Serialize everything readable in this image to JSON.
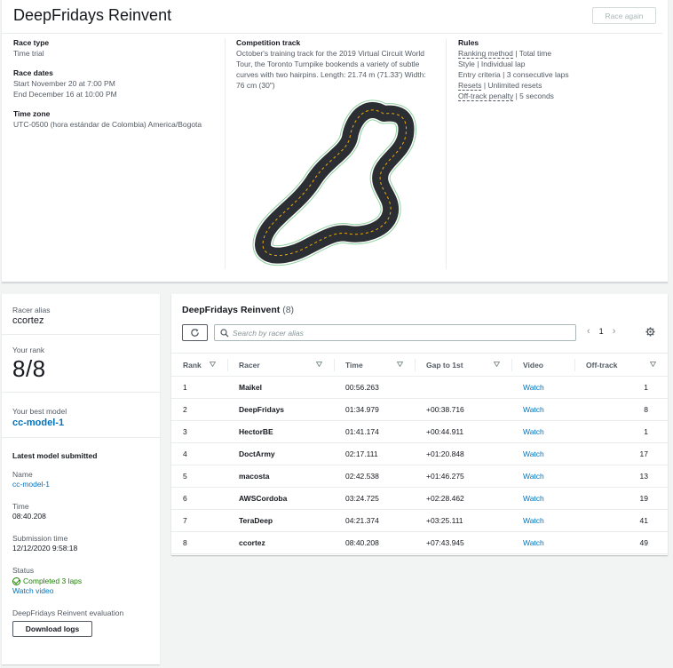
{
  "race": {
    "title": "DeepFridays Reinvent",
    "race_again": "Race again",
    "type_label": "Race type",
    "type_value": "Time trial",
    "dates_label": "Race dates",
    "start": "Start November 20 at 7:00 PM",
    "end": "End December 16 at 10:00 PM",
    "tz_label": "Time zone",
    "tz_value": "UTC-0500 (hora estándar de Colombia) America/Bogota",
    "track_label": "Competition track",
    "track_desc": "October's training track for the 2019 Virtual Circuit World Tour, the Toronto Turnpike bookends a variety of subtle curves with two hairpins. Length: 21.74 m (71.33') Width: 76 cm (30\")",
    "rules_label": "Rules",
    "rules": {
      "ranking_key": "Ranking method",
      "ranking_val": "Total time",
      "style_key": "Style",
      "style_val": "Individual lap",
      "entry_key": "Entry criteria",
      "entry_val": "3 consecutive laps",
      "resets_key": "Resets",
      "resets_val": "Unlimited resets",
      "offtrack_key": "Off-track penalty",
      "offtrack_val": "5 seconds"
    },
    "separator": "|"
  },
  "profile": {
    "alias_label": "Racer alias",
    "alias": "ccortez",
    "rank_label": "Your rank",
    "rank": "8/8",
    "best_label": "Your best model",
    "best_model": "cc-model-1",
    "latest_head": "Latest model submitted",
    "name_label": "Name",
    "name_value": "cc-model-1",
    "time_label": "Time",
    "time_value": "08:40.208",
    "sub_label": "Submission time",
    "sub_value": "12/12/2020 9:58:18",
    "status_label": "Status",
    "status_value": "Completed 3 laps",
    "watch_video": "Watch video",
    "eval_label": "DeepFridays Reinvent evaluation",
    "download": "Download logs"
  },
  "board": {
    "title": "DeepFridays Reinvent",
    "count": "(8)",
    "search_placeholder": "Search by racer alias",
    "page": "1",
    "columns": {
      "rank": "Rank",
      "racer": "Racer",
      "time": "Time",
      "gap": "Gap to 1st",
      "video": "Video",
      "offtrack": "Off-track"
    },
    "rows": [
      {
        "rank": "1",
        "racer": "Maikel",
        "time": "00:56.263",
        "gap": "",
        "video": "Watch",
        "off": "1"
      },
      {
        "rank": "2",
        "racer": "DeepFridays",
        "time": "01:34.979",
        "gap": "+00:38.716",
        "video": "Watch",
        "off": "8"
      },
      {
        "rank": "3",
        "racer": "HectorBE",
        "time": "01:41.174",
        "gap": "+00:44.911",
        "video": "Watch",
        "off": "1"
      },
      {
        "rank": "4",
        "racer": "DoctArmy",
        "time": "02:17.111",
        "gap": "+01:20.848",
        "video": "Watch",
        "off": "17"
      },
      {
        "rank": "5",
        "racer": "macosta",
        "time": "02:42.538",
        "gap": "+01:46.275",
        "video": "Watch",
        "off": "13"
      },
      {
        "rank": "6",
        "racer": "AWSCordoba",
        "time": "03:24.725",
        "gap": "+02:28.462",
        "video": "Watch",
        "off": "19"
      },
      {
        "rank": "7",
        "racer": "TeraDeep",
        "time": "04:21.374",
        "gap": "+03:25.111",
        "video": "Watch",
        "off": "41"
      },
      {
        "rank": "8",
        "racer": "ccortez",
        "time": "08:40.208",
        "gap": "+07:43.945",
        "video": "Watch",
        "off": "49"
      }
    ]
  },
  "colors": {
    "link": "#0073bb",
    "success": "#1d8102",
    "track_surface": "#2b2f33",
    "track_border": "#8fd19e",
    "track_center": "#f2a900"
  }
}
